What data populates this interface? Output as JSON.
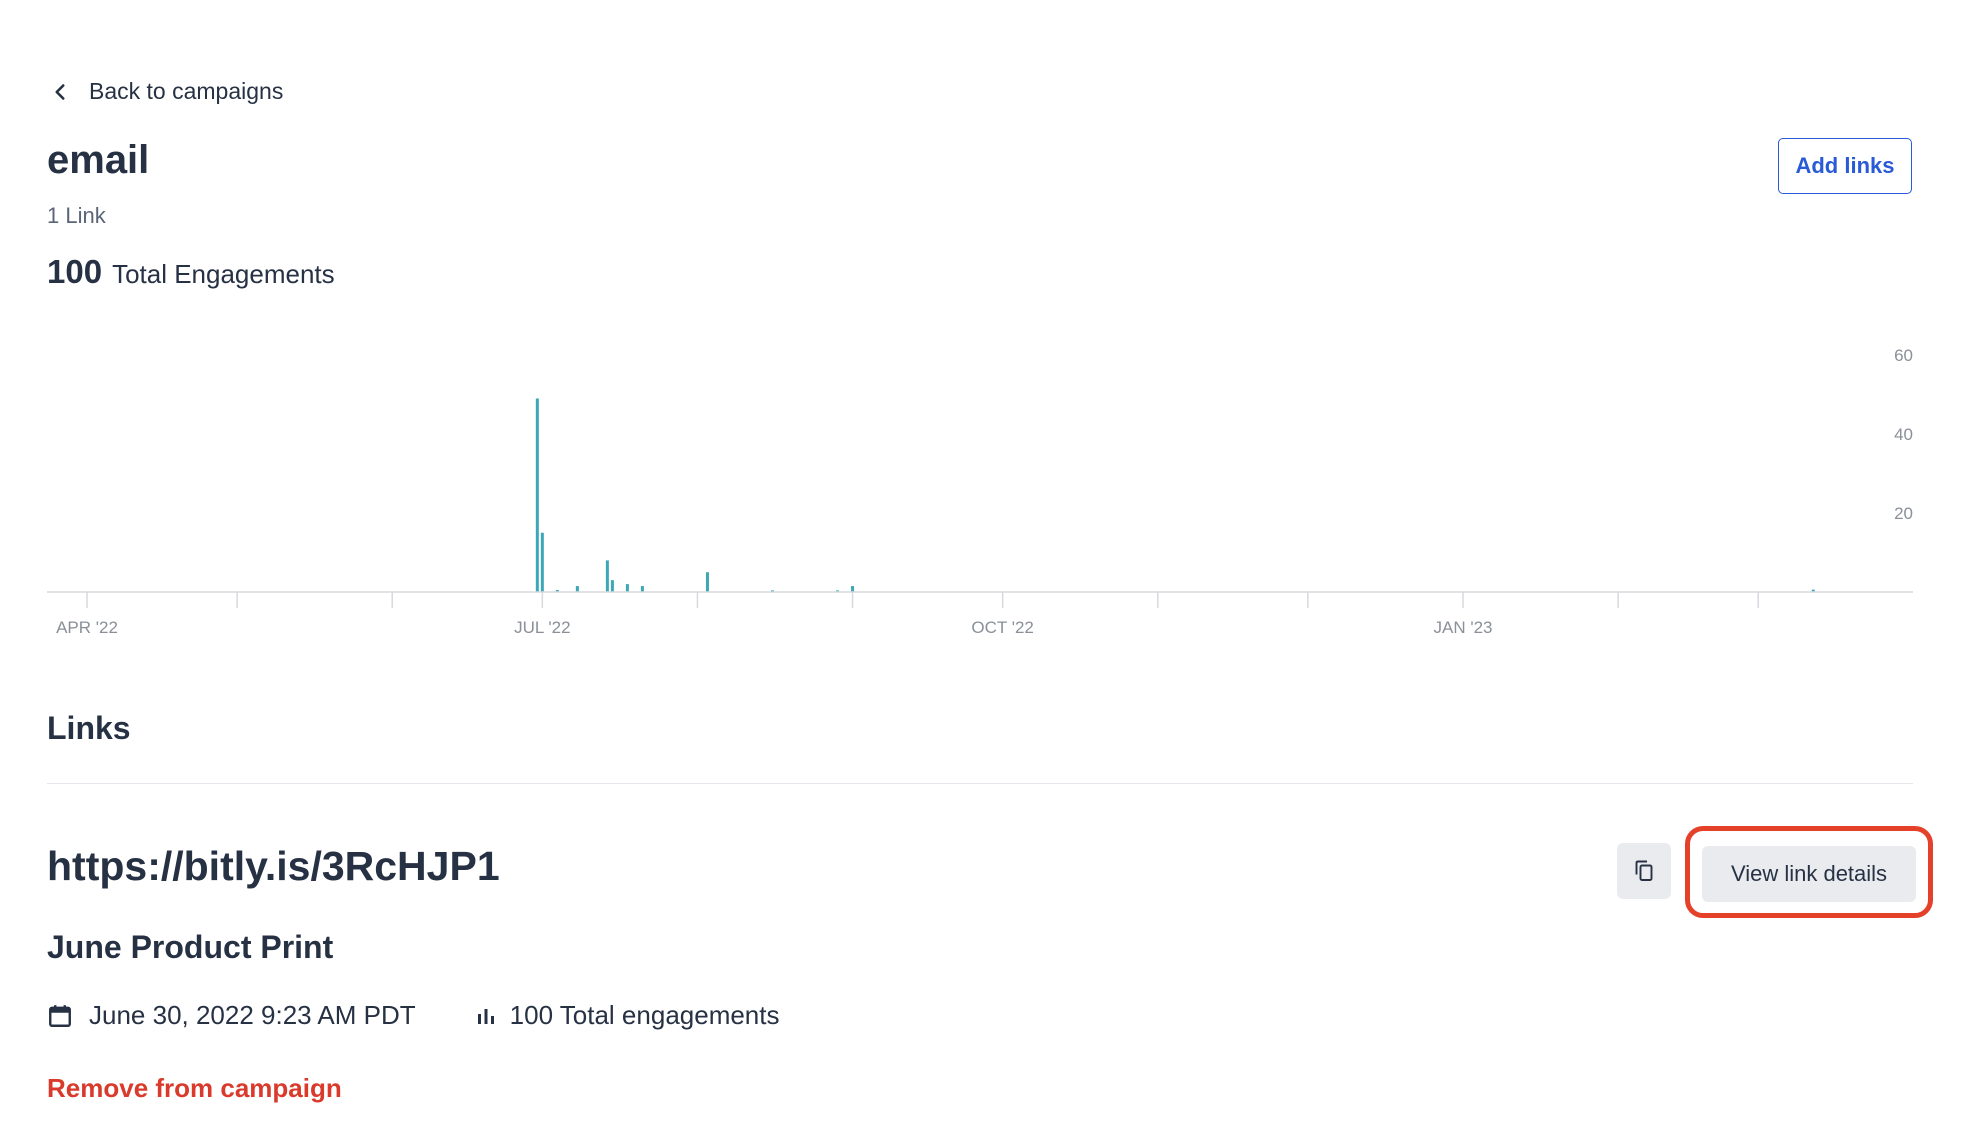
{
  "nav": {
    "back_label": "Back to campaigns"
  },
  "campaign": {
    "title": "email",
    "link_count": "1 Link",
    "total_number": "100",
    "total_label": "Total Engagements",
    "add_links_label": "Add links"
  },
  "chart_data": {
    "type": "bar",
    "x_unit": "date",
    "x_ticks": [
      "APR '22",
      "JUL '22",
      "OCT '22",
      "JAN '23"
    ],
    "y_ticks": [
      20,
      40,
      60
    ],
    "ylim": [
      0,
      60
    ],
    "color": "#3ca7b5",
    "grid": false,
    "points": [
      {
        "x": "2022-06-30",
        "y": 49
      },
      {
        "x": "2022-07-01",
        "y": 15
      },
      {
        "x": "2022-07-04",
        "y": 0.5
      },
      {
        "x": "2022-07-08",
        "y": 1.5
      },
      {
        "x": "2022-07-14",
        "y": 8
      },
      {
        "x": "2022-07-15",
        "y": 3
      },
      {
        "x": "2022-07-18",
        "y": 2
      },
      {
        "x": "2022-07-21",
        "y": 1.5
      },
      {
        "x": "2022-08-03",
        "y": 5
      },
      {
        "x": "2022-08-16",
        "y": 0.4
      },
      {
        "x": "2022-08-29",
        "y": 0.4
      },
      {
        "x": "2022-09-01",
        "y": 1.5
      },
      {
        "x": "2023-03-12",
        "y": 0.6
      }
    ]
  },
  "links_section": {
    "title": "Links"
  },
  "link": {
    "url": "https://bitly.is/3RcHJP1",
    "title": "June Product Print",
    "date": "June 30, 2022 9:23 AM PDT",
    "engagements": "100 Total engagements",
    "view_details_label": "View link details",
    "remove_label": "Remove from campaign"
  },
  "icons": {
    "back": "chevron-left-icon",
    "copy": "copy-icon",
    "calendar": "calendar-icon",
    "engagement": "bar-chart-icon"
  },
  "colors": {
    "primary": "#2a5bd7",
    "danger": "#d93a2b",
    "highlight": "#e5402a",
    "bar": "#3ca7b5"
  }
}
